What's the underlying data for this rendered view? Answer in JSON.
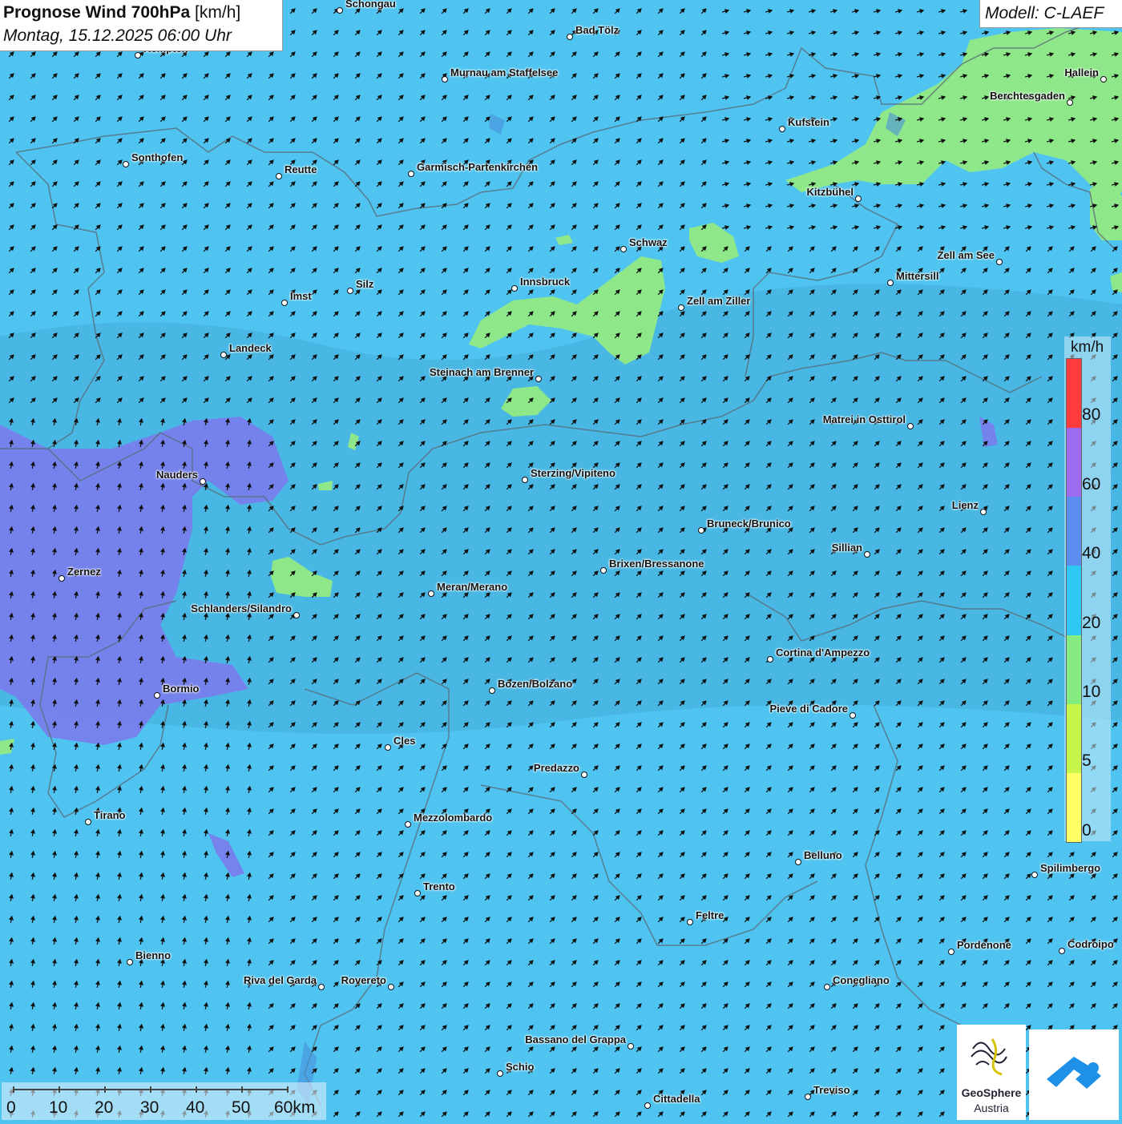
{
  "header": {
    "title_bold": "Prognose Wind 700hPa",
    "title_unit": "[km/h]",
    "datetime": "Montag, 15.12.2025 06:00 Uhr",
    "model": "Modell: C-LAEF"
  },
  "legend": {
    "unit": "km/h",
    "ticks": [
      "80",
      "60",
      "40",
      "20",
      "10",
      "5",
      "0"
    ],
    "colors": [
      "#ff3b3b",
      "#9b6bf0",
      "#5b8ef0",
      "#2ec8f5",
      "#84ec80",
      "#c8f54a",
      "#ffff66"
    ]
  },
  "scale_bar": {
    "labels": [
      "0",
      "10",
      "20",
      "30",
      "40",
      "50",
      "60km"
    ]
  },
  "logos": {
    "geosphere_name": "GeoSphere",
    "geosphere_sub": "Austria"
  },
  "map_colors": {
    "background": "#4fc4f0",
    "calm_zone": "#8ee88a",
    "strong_zone": "#7a7cec",
    "border": "#666666"
  },
  "cities": [
    {
      "name": "Schongau"
    },
    {
      "name": "Bad Tölz"
    },
    {
      "name": "Kempten"
    },
    {
      "name": "Murnau am Staffelsee"
    },
    {
      "name": "Hallein"
    },
    {
      "name": "Berchtesgaden"
    },
    {
      "name": "Kufstein"
    },
    {
      "name": "Sonthofen"
    },
    {
      "name": "Reutte"
    },
    {
      "name": "Garmisch-Partenkirchen"
    },
    {
      "name": "Kitzbühel"
    },
    {
      "name": "Schwaz"
    },
    {
      "name": "Zell am See"
    },
    {
      "name": "Mittersill"
    },
    {
      "name": "Innsbruck"
    },
    {
      "name": "Silz"
    },
    {
      "name": "Imst"
    },
    {
      "name": "Zell am Ziller"
    },
    {
      "name": "Landeck"
    },
    {
      "name": "Steinach am Brenner"
    },
    {
      "name": "Matrei in Osttirol"
    },
    {
      "name": "Nauders"
    },
    {
      "name": "Sterzing/Vipiteno"
    },
    {
      "name": "Lienz"
    },
    {
      "name": "Bruneck/Brunico"
    },
    {
      "name": "Sillian"
    },
    {
      "name": "Brixen/Bressanone"
    },
    {
      "name": "Zernez"
    },
    {
      "name": "Meran/Merano"
    },
    {
      "name": "Schlanders/Silandro"
    },
    {
      "name": "Cortina d'Ampezzo"
    },
    {
      "name": "Bozen/Bolzano"
    },
    {
      "name": "Bormio"
    },
    {
      "name": "Pieve di Cadore"
    },
    {
      "name": "Cles"
    },
    {
      "name": "Predazzo"
    },
    {
      "name": "Tirano"
    },
    {
      "name": "Mezzolombardo"
    },
    {
      "name": "Belluno"
    },
    {
      "name": "Spilimbergo"
    },
    {
      "name": "Trento"
    },
    {
      "name": "Feltre"
    },
    {
      "name": "Pordenone"
    },
    {
      "name": "Codroipo"
    },
    {
      "name": "Bienno"
    },
    {
      "name": "Riva del Garda"
    },
    {
      "name": "Rovereto"
    },
    {
      "name": "Conegliano"
    },
    {
      "name": "Bassano del Grappa"
    },
    {
      "name": "Schio"
    },
    {
      "name": "Treviso"
    },
    {
      "name": "Cittadella"
    }
  ]
}
